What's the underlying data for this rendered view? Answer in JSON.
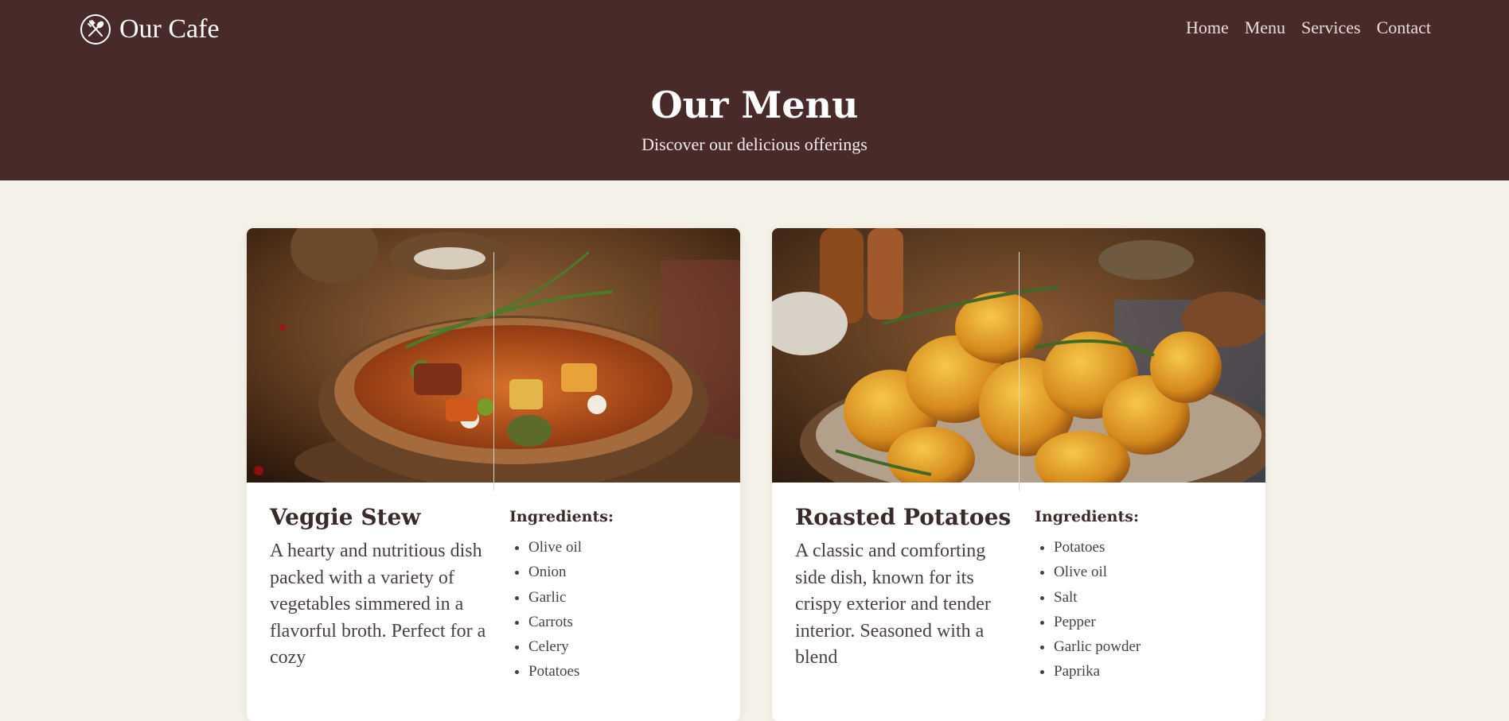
{
  "header": {
    "brand": "Our Cafe",
    "nav": [
      "Home",
      "Menu",
      "Services",
      "Contact"
    ],
    "hero_title": "Our Menu",
    "hero_subtitle": "Discover our delicious offerings"
  },
  "cards": [
    {
      "title": "Veggie Stew",
      "description": "A hearty and nutritious dish packed with a variety of vegetables simmered in a flavorful broth. Perfect for a cozy",
      "ingredients_label": "Ingredients:",
      "ingredients": [
        "Olive oil",
        "Onion",
        "Garlic",
        "Carrots",
        "Celery",
        "Potatoes"
      ]
    },
    {
      "title": "Roasted Potatoes",
      "description": "A classic and comforting side dish, known for its crispy exterior and tender interior. Seasoned with a blend",
      "ingredients_label": "Ingredients:",
      "ingredients": [
        "Potatoes",
        "Olive oil",
        "Salt",
        "Pepper",
        "Garlic powder",
        "Paprika"
      ]
    }
  ],
  "colors": {
    "header_bg": "#482a29",
    "page_bg": "#f5f2e9",
    "card_bg": "#ffffff",
    "text_dark": "#3a2a2a"
  }
}
